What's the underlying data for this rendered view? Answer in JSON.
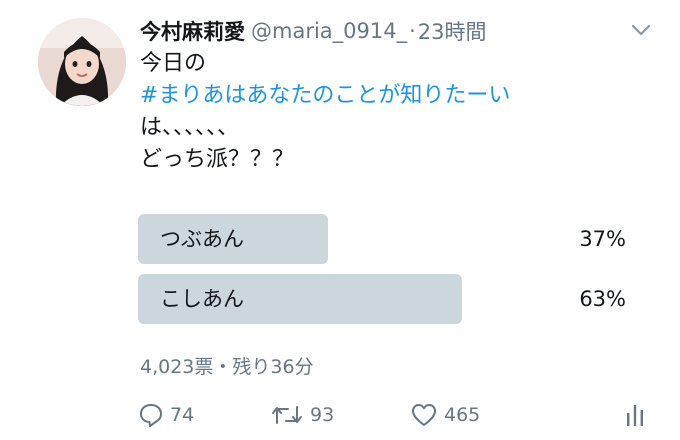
{
  "tweet": {
    "author_name": "今村麻莉愛",
    "handle": "@maria_0914_",
    "separator": "·",
    "time": "23時間",
    "text_line1": "今日の",
    "hashtag": "#まりあはあなたのことが知りたーい",
    "text_line3": "は、、、、、、",
    "text_line4": "どっち派？？？"
  },
  "poll": {
    "options": [
      {
        "label": "つぶあん",
        "percent_text": "37%",
        "share": 0.37
      },
      {
        "label": "こしあん",
        "percent_text": "63%",
        "share": 0.63
      }
    ],
    "meta": "4,023票・残り36分"
  },
  "actions": {
    "reply_count": "74",
    "retweet_count": "93",
    "like_count": "465"
  },
  "icons": [
    "chevron-down-icon",
    "reply-icon",
    "retweet-icon",
    "heart-icon",
    "analytics-icon"
  ],
  "colors": {
    "hashtag": "#1b95e0",
    "bar": "#ccd6dd",
    "secondary_text": "#657786"
  }
}
